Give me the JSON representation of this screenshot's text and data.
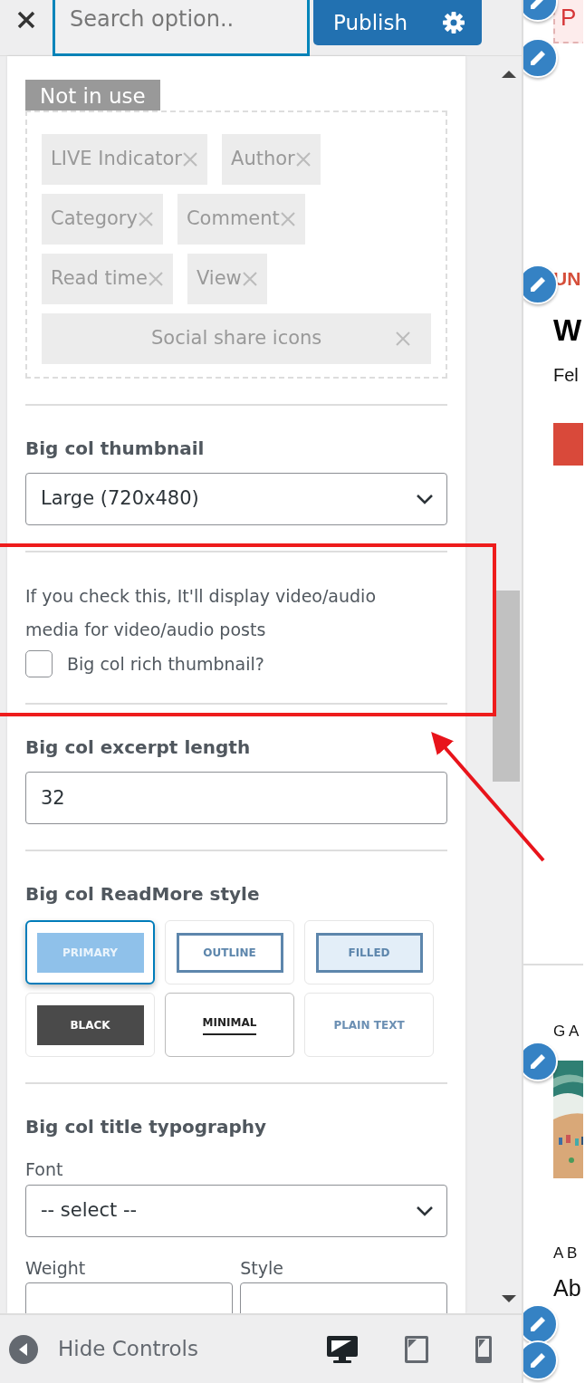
{
  "header": {
    "search_placeholder": "Search option..",
    "publish": "Publish"
  },
  "not_in_use": {
    "label": "Not in use",
    "items": [
      {
        "label": "LIVE Indicator",
        "kind": "chip"
      },
      {
        "label": "Author",
        "kind": "chip"
      },
      {
        "label": "Category",
        "kind": "chip"
      },
      {
        "label": "Comment",
        "kind": "chip"
      },
      {
        "label": "Read time",
        "kind": "chip"
      },
      {
        "label": "View",
        "kind": "chip"
      },
      {
        "label": "Social share icons",
        "kind": "wide"
      }
    ]
  },
  "thumbnail": {
    "label": "Big col thumbnail",
    "value": "Large (720x480)"
  },
  "rich_thumbnail": {
    "description": "If you check this, It'll display video/audio media for video/audio posts",
    "label": "Big col rich thumbnail?",
    "checked": false
  },
  "excerpt": {
    "label": "Big col excerpt length",
    "value": "32"
  },
  "readmore": {
    "label": "Big col ReadMore style",
    "options": [
      {
        "label": "PRIMARY",
        "kind": "primary",
        "selected": true
      },
      {
        "label": "OUTLINE",
        "kind": "outline",
        "selected": false
      },
      {
        "label": "FILLED",
        "kind": "filled",
        "selected": false
      },
      {
        "label": "BLACK",
        "kind": "black",
        "selected": false
      },
      {
        "label": "MINIMAL",
        "kind": "minimal",
        "selected": false
      },
      {
        "label": "PLAIN TEXT",
        "kind": "plain",
        "selected": false
      }
    ]
  },
  "typography": {
    "label": "Big col title typography",
    "font_label": "Font",
    "font_value": "-- select --",
    "weight_label": "Weight",
    "style_label": "Style"
  },
  "footer": {
    "hide_controls": "Hide Controls",
    "devices": [
      {
        "kind": "desktop",
        "selected": true
      },
      {
        "kind": "tablet",
        "selected": false
      },
      {
        "kind": "mobile",
        "selected": false
      }
    ]
  },
  "preview": [
    {
      "kind": "badge",
      "text": "P"
    },
    {
      "kind": "category",
      "text": "UN"
    },
    {
      "kind": "heading",
      "text": "W"
    },
    {
      "kind": "meta",
      "text": "Fel"
    },
    {
      "kind": "button"
    },
    {
      "kind": "divider"
    },
    {
      "kind": "category-small",
      "text": "G A"
    },
    {
      "kind": "picture"
    },
    {
      "kind": "category-small",
      "text": "A B"
    },
    {
      "kind": "title",
      "text": "Ab"
    }
  ]
}
